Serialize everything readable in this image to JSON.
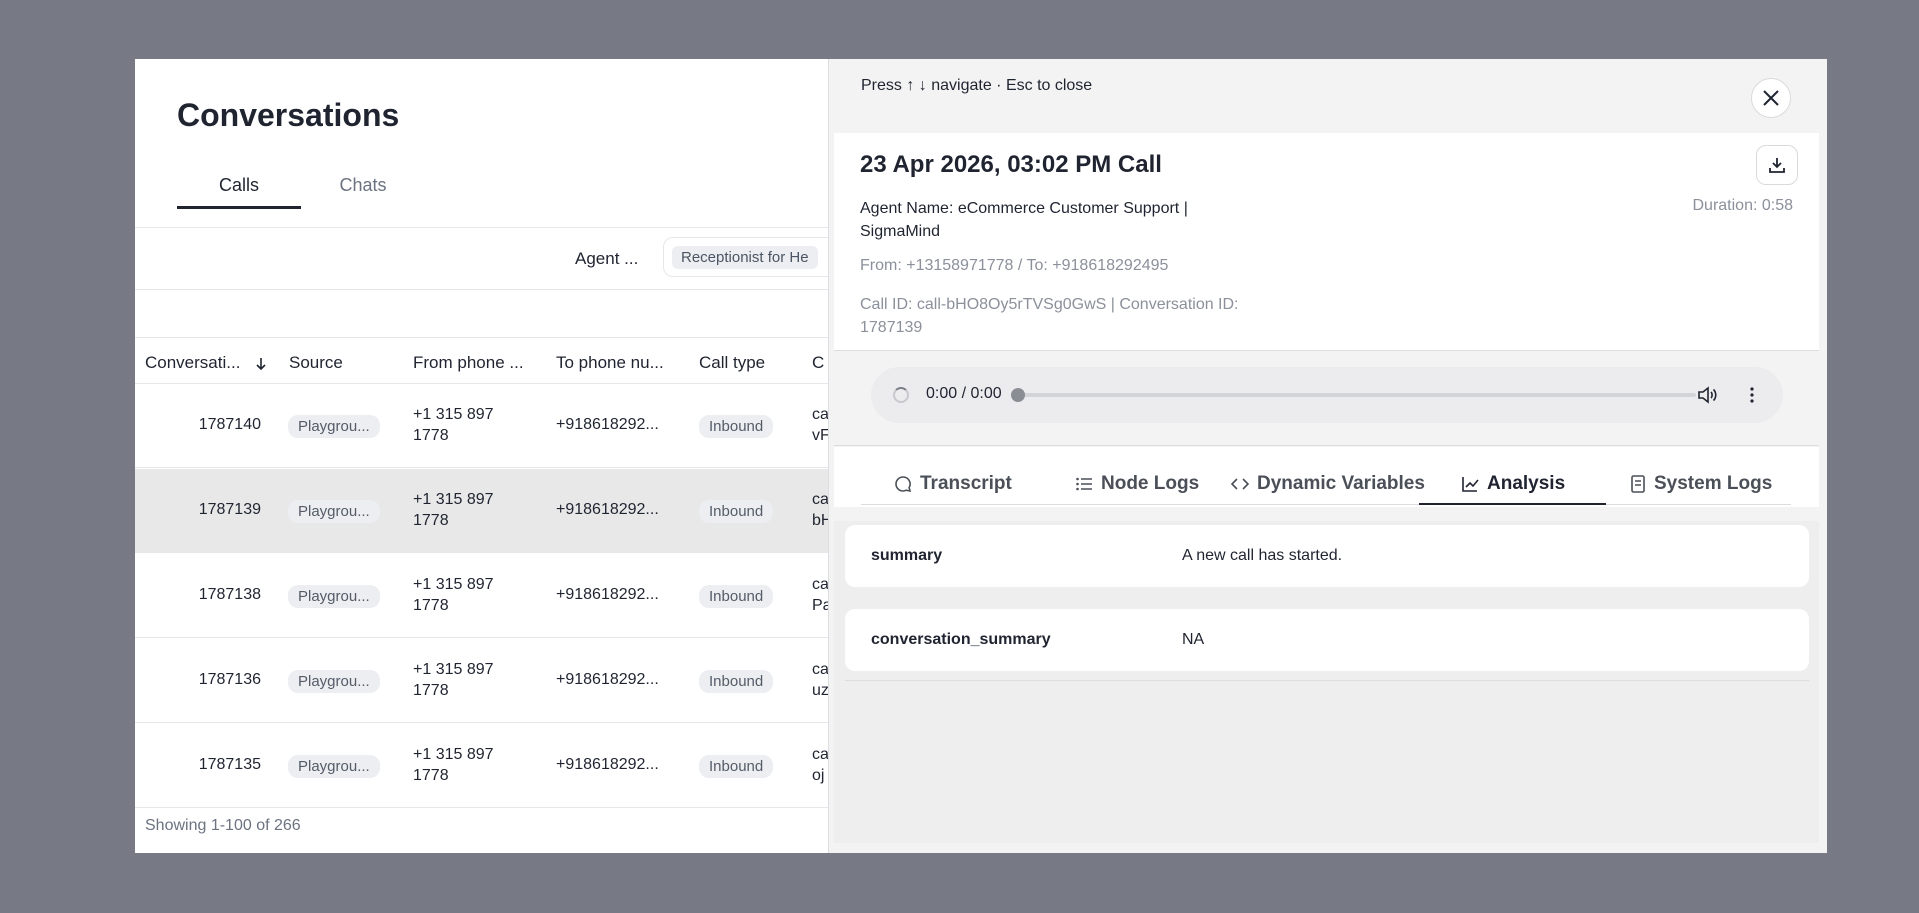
{
  "conversations": {
    "title": "Conversations",
    "tabs": [
      {
        "label": "Calls",
        "active": true
      },
      {
        "label": "Chats",
        "active": false
      }
    ],
    "filter": {
      "label": "Agent ...",
      "chip": "Receptionist for He"
    },
    "columns": [
      "Conversati...",
      "Source",
      "From phone ...",
      "To phone nu...",
      "Call type",
      "C"
    ],
    "rows": [
      {
        "id": "1787140",
        "source": "Playgrou...",
        "from_line1": "+1 315 897",
        "from_line2": "1778",
        "to": "+918618292...",
        "type": "Inbound",
        "c1": "ca",
        "c2": "vF"
      },
      {
        "id": "1787139",
        "source": "Playgrou...",
        "from_line1": "+1 315 897",
        "from_line2": "1778",
        "to": "+918618292...",
        "type": "Inbound",
        "c1": "ca",
        "c2": "bH"
      },
      {
        "id": "1787138",
        "source": "Playgrou...",
        "from_line1": "+1 315 897",
        "from_line2": "1778",
        "to": "+918618292...",
        "type": "Inbound",
        "c1": "ca",
        "c2": "Pa"
      },
      {
        "id": "1787136",
        "source": "Playgrou...",
        "from_line1": "+1 315 897",
        "from_line2": "1778",
        "to": "+918618292...",
        "type": "Inbound",
        "c1": "ca",
        "c2": "uz"
      },
      {
        "id": "1787135",
        "source": "Playgrou...",
        "from_line1": "+1 315 897",
        "from_line2": "1778",
        "to": "+918618292...",
        "type": "Inbound",
        "c1": "ca",
        "c2": "oj"
      }
    ],
    "footer": "Showing 1-100 of 266"
  },
  "panel": {
    "hint": "Press ↑ ↓ navigate · Esc to close",
    "call_title": "23 Apr 2026, 03:02 PM Call",
    "duration": "Duration: 0:58",
    "agent": "Agent Name: eCommerce Customer Support | SigmaMind",
    "from_to": "From: +13158971778 / To: +918618292495",
    "call_id": "Call ID: call-bHO8Oy5rTVSg0GwS | Conversation ID: 1787139",
    "audio": {
      "time": "0:00 / 0:00"
    },
    "tabs": [
      {
        "label": "Transcript",
        "icon": "chat-bubble-icon"
      },
      {
        "label": "Node Logs",
        "icon": "list-icon"
      },
      {
        "label": "Dynamic Variables",
        "icon": "code-icon"
      },
      {
        "label": "Analysis",
        "icon": "chart-icon",
        "active": true
      },
      {
        "label": "System Logs",
        "icon": "document-icon"
      }
    ],
    "analysis": [
      {
        "key": "summary",
        "value": "A new call has started."
      },
      {
        "key": "conversation_summary",
        "value": "NA"
      }
    ]
  }
}
